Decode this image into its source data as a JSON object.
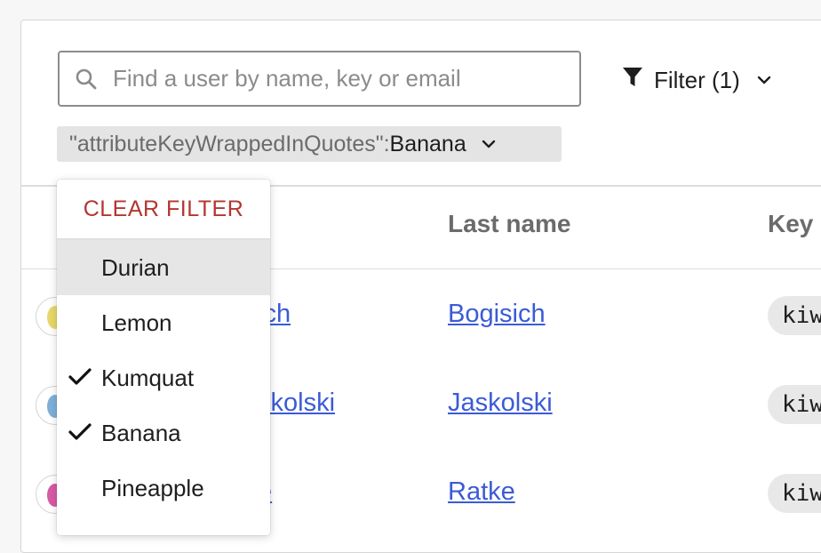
{
  "search": {
    "placeholder": "Find a user by name, key or email",
    "value": ""
  },
  "filter": {
    "label": "Filter (1)"
  },
  "active_filter": {
    "key": "\"attributeKeyWrappedInQuotes\": ",
    "value": "Banana"
  },
  "table": {
    "headers": {
      "last_name": "Last name",
      "key": "Key"
    },
    "rows": [
      {
        "first_name_partial": "ich",
        "last_name": "Bogisich",
        "key_partial": "kiw",
        "avatar_color": "#e8d86a"
      },
      {
        "first_name_partial": "skolski",
        "last_name": "Jaskolski",
        "key_partial": "kiw",
        "avatar_color": "#7fb0d8"
      },
      {
        "first_name_partial": "e",
        "last_name": "Ratke",
        "key_partial": "kiw",
        "avatar_color": "#d85aa6"
      }
    ]
  },
  "dropdown": {
    "clear_label": "CLEAR FILTER",
    "options": [
      {
        "label": "Durian",
        "checked": false,
        "highlighted": true
      },
      {
        "label": "Lemon",
        "checked": false,
        "highlighted": false
      },
      {
        "label": "Kumquat",
        "checked": true,
        "highlighted": false
      },
      {
        "label": "Banana",
        "checked": true,
        "highlighted": false
      },
      {
        "label": "Pineapple",
        "checked": false,
        "highlighted": false
      }
    ]
  },
  "colors": {
    "link": "#3b5bd6",
    "clear": "#b3362f",
    "chip_bg": "#e4e4e4"
  }
}
